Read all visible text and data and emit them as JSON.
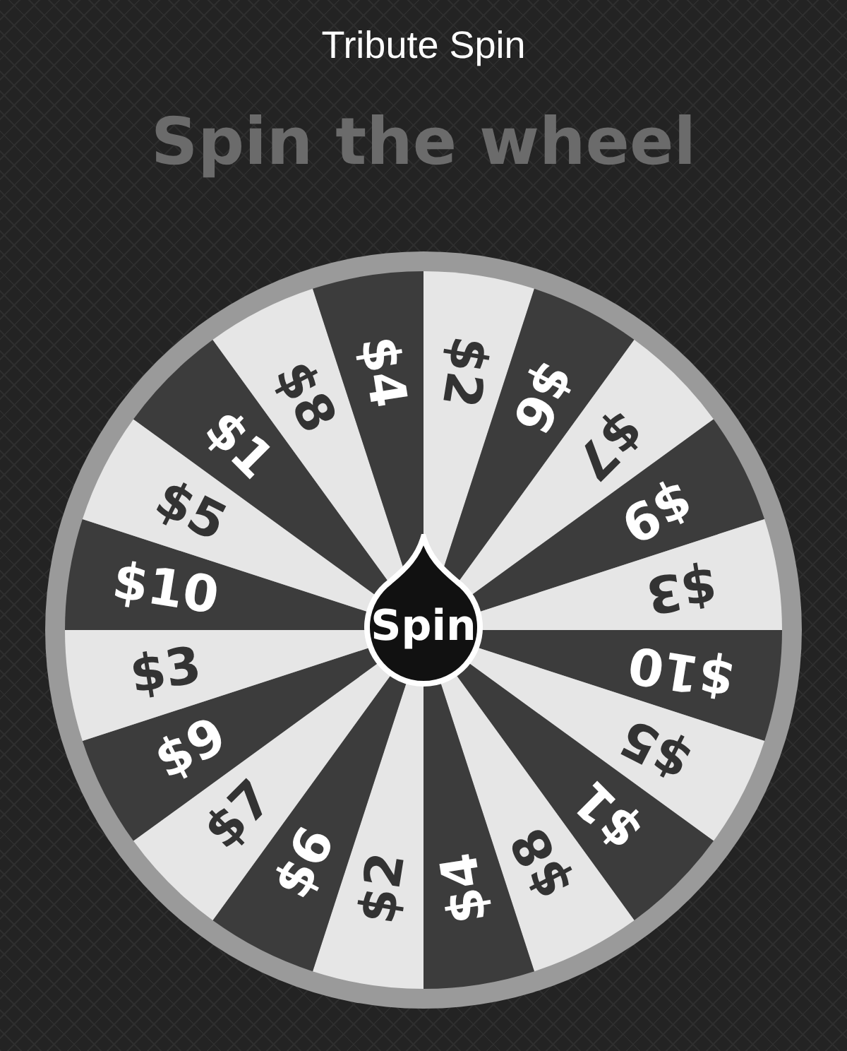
{
  "title": "Tribute Spin",
  "heading": "Spin the wheel",
  "segments": [
    {
      "label": "$2",
      "color": "#e6e6e6"
    },
    {
      "label": "$6",
      "color": "#3c3c3c"
    },
    {
      "label": "$7",
      "color": "#e6e6e6"
    },
    {
      "label": "$9",
      "color": "#3c3c3c"
    },
    {
      "label": "$3",
      "color": "#e6e6e6"
    },
    {
      "label": "$10",
      "color": "#3c3c3c"
    },
    {
      "label": "$5",
      "color": "#e6e6e6"
    },
    {
      "label": "$1",
      "color": "#3c3c3c"
    },
    {
      "label": "$8",
      "color": "#e6e6e6"
    },
    {
      "label": "$4",
      "color": "#3c3c3c"
    },
    {
      "label": "$2",
      "color": "#e6e6e6"
    },
    {
      "label": "$6",
      "color": "#3c3c3c"
    },
    {
      "label": "$7",
      "color": "#e6e6e6"
    },
    {
      "label": "$9",
      "color": "#3c3c3c"
    },
    {
      "label": "$3",
      "color": "#e6e6e6"
    },
    {
      "label": "$10",
      "color": "#3c3c3c"
    },
    {
      "label": "$5",
      "color": "#e6e6e6"
    },
    {
      "label": "$1",
      "color": "#3c3c3c"
    },
    {
      "label": "$8",
      "color": "#e6e6e6"
    },
    {
      "label": "$4",
      "color": "#3c3c3c"
    }
  ],
  "spin_button": "Spin"
}
